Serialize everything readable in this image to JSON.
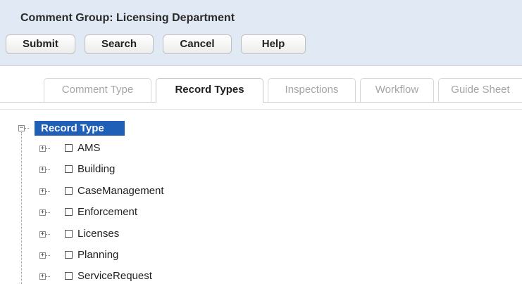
{
  "header": {
    "title": "Comment Group: Licensing Department",
    "buttons": {
      "submit": "Submit",
      "search": "Search",
      "cancel": "Cancel",
      "help": "Help"
    }
  },
  "tabs": [
    {
      "label": "Comment Type",
      "active": false
    },
    {
      "label": "Record Types",
      "active": true
    },
    {
      "label": "Inspections",
      "active": false
    },
    {
      "label": "Workflow",
      "active": false
    },
    {
      "label": "Guide Sheet",
      "active": false
    }
  ],
  "tree": {
    "root": {
      "label": "Record Type",
      "expanded": true,
      "toggle": "−"
    },
    "items": [
      {
        "label": "AMS",
        "checked": false,
        "toggle": "+"
      },
      {
        "label": "Building",
        "checked": false,
        "toggle": "+"
      },
      {
        "label": "CaseManagement",
        "checked": false,
        "toggle": "+"
      },
      {
        "label": "Enforcement",
        "checked": false,
        "toggle": "+"
      },
      {
        "label": "Licenses",
        "checked": false,
        "toggle": "+"
      },
      {
        "label": "Planning",
        "checked": false,
        "toggle": "+"
      },
      {
        "label": "ServiceRequest",
        "checked": false,
        "toggle": "+"
      }
    ]
  },
  "colors": {
    "header_bg": "#e1e9f4",
    "selected_node_bg": "#1f5fb7",
    "inactive_tab_text": "#a5a5a5"
  }
}
